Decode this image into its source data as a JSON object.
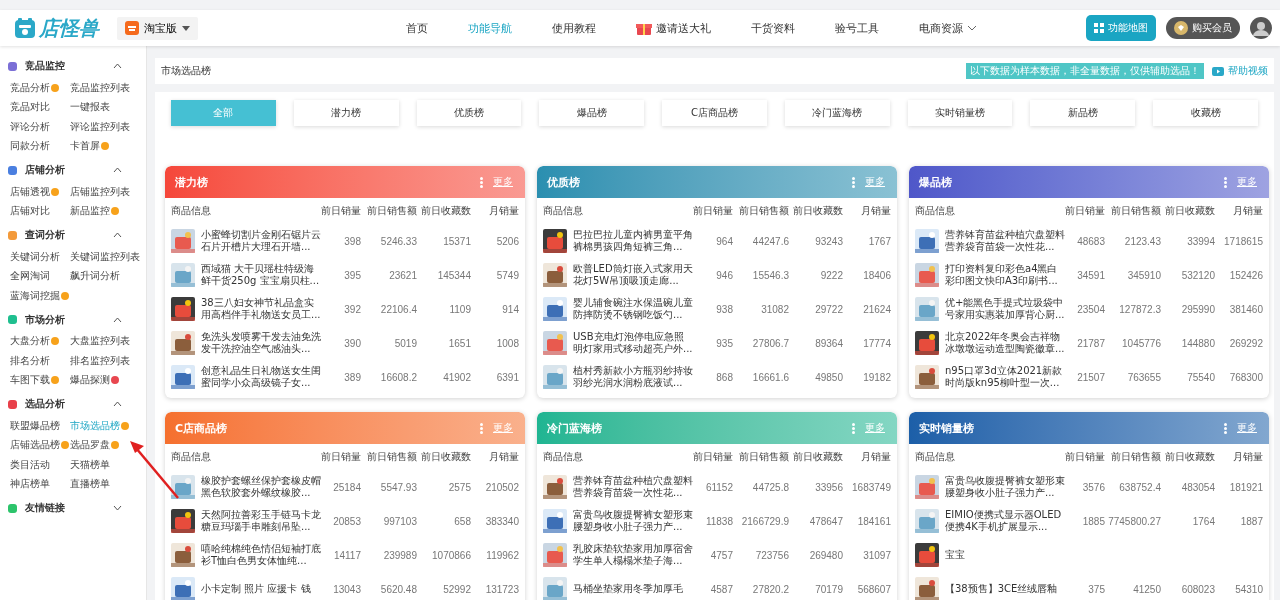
{
  "topbar": {
    "logo": "店怪兽",
    "version": "淘宝版",
    "nav": [
      {
        "label": "首页",
        "selected": false,
        "kind": "plain"
      },
      {
        "label": "功能导航",
        "selected": true,
        "kind": "plain"
      },
      {
        "label": "使用教程",
        "selected": false,
        "kind": "plain"
      },
      {
        "label": "邀请送大礼",
        "selected": false,
        "kind": "gift"
      },
      {
        "label": "干货资料",
        "selected": false,
        "kind": "plain"
      },
      {
        "label": "验号工具",
        "selected": false,
        "kind": "plain"
      },
      {
        "label": "电商资源",
        "selected": false,
        "kind": "dropdown"
      }
    ],
    "map_button": "功能地图",
    "member_button": "购买会员"
  },
  "sidebar": [
    {
      "title": "竞品监控",
      "color": "#7b6fd6",
      "expanded": true,
      "items": [
        {
          "label": "竞品分析",
          "kind": "hot",
          "selected": false
        },
        {
          "label": "竞品监控列表",
          "kind": "plain",
          "selected": false
        },
        {
          "label": "竞品对比",
          "kind": "plain",
          "selected": false
        },
        {
          "label": "一键报表",
          "kind": "plain",
          "selected": false
        },
        {
          "label": "评论分析",
          "kind": "plain",
          "selected": false
        },
        {
          "label": "评论监控列表",
          "kind": "plain",
          "selected": false
        },
        {
          "label": "同款分析",
          "kind": "plain",
          "selected": false
        },
        {
          "label": "卡首屏",
          "kind": "hot",
          "selected": false
        }
      ]
    },
    {
      "title": "店铺分析",
      "color": "#4a7fe0",
      "expanded": true,
      "items": [
        {
          "label": "店铺透视",
          "kind": "hot",
          "selected": false
        },
        {
          "label": "店铺监控列表",
          "kind": "plain",
          "selected": false
        },
        {
          "label": "店铺对比",
          "kind": "plain",
          "selected": false
        },
        {
          "label": "新品监控",
          "kind": "hot",
          "selected": false
        }
      ]
    },
    {
      "title": "查词分析",
      "color": "#f39a3a",
      "expanded": true,
      "items": [
        {
          "label": "关键词分析",
          "kind": "plain",
          "selected": false
        },
        {
          "label": "关键词监控列表",
          "kind": "plain",
          "selected": false
        },
        {
          "label": "全网淘词",
          "kind": "plain",
          "selected": false
        },
        {
          "label": "飙升词分析",
          "kind": "plain",
          "selected": false
        },
        {
          "label": "蓝海词挖掘",
          "kind": "hot",
          "selected": false
        }
      ]
    },
    {
      "title": "市场分析",
      "color": "#1fbf8f",
      "expanded": true,
      "items": [
        {
          "label": "大盘分析",
          "kind": "hot",
          "selected": false
        },
        {
          "label": "大盘监控列表",
          "kind": "plain",
          "selected": false
        },
        {
          "label": "排名分析",
          "kind": "plain",
          "selected": false
        },
        {
          "label": "排名监控列表",
          "kind": "plain",
          "selected": false
        },
        {
          "label": "车图下载",
          "kind": "hot",
          "selected": false
        },
        {
          "label": "爆品探测",
          "kind": "new",
          "selected": false
        }
      ]
    },
    {
      "title": "选品分析",
      "color": "#e8404a",
      "expanded": true,
      "items": [
        {
          "label": "联盟爆品榜",
          "kind": "plain",
          "selected": false
        },
        {
          "label": "市场选品榜",
          "kind": "hot",
          "selected": true
        },
        {
          "label": "店铺选品榜",
          "kind": "hot",
          "selected": false
        },
        {
          "label": "选品罗盘",
          "kind": "hot",
          "selected": false
        },
        {
          "label": "类目活动",
          "kind": "plain",
          "selected": false
        },
        {
          "label": "天猫榜单",
          "kind": "plain",
          "selected": false
        },
        {
          "label": "神店榜单",
          "kind": "plain",
          "selected": false
        },
        {
          "label": "直播榜单",
          "kind": "plain",
          "selected": false
        }
      ]
    },
    {
      "title": "友情链接",
      "color": "#2cc46b",
      "expanded": false
    }
  ],
  "page": {
    "title": "市场选品榜",
    "notice": "以下数据为样本数据，非全量数据，仅供辅助选品！",
    "help": "帮助视频"
  },
  "tabs": [
    {
      "label": "全部",
      "selected": true
    },
    {
      "label": "潜力榜",
      "selected": false
    },
    {
      "label": "优质榜",
      "selected": false
    },
    {
      "label": "爆品榜",
      "selected": false
    },
    {
      "label": "C店商品榜",
      "selected": false
    },
    {
      "label": "冷门蓝海榜",
      "selected": false
    },
    {
      "label": "实时销量榜",
      "selected": false
    },
    {
      "label": "新品榜",
      "selected": false
    },
    {
      "label": "收藏榜",
      "selected": false
    }
  ],
  "cards": [
    {
      "title": "潜力榜",
      "color": "#f5473a",
      "more": "更多",
      "columns": [
        "商品信息",
        "前日销量",
        "前日销售额",
        "前日收藏数",
        "月销量"
      ],
      "rows": [
        {
          "name": "小蜜蜂切割片金刚石锯片云石片开槽片大理石开墙...",
          "sales": "398",
          "revenue": "5246.33",
          "favorites": "15371",
          "monthly": "5206"
        },
        {
          "name": "西域猫 大干贝瑶柱特级海鲜干货250g 宝宝扇贝柱...",
          "sales": "395",
          "revenue": "23621",
          "favorites": "145344",
          "monthly": "5749"
        },
        {
          "name": "38三八妇女神节礼品盒实用高档伴手礼物送女员工...",
          "sales": "392",
          "revenue": "22106.4",
          "favorites": "1109",
          "monthly": "914"
        },
        {
          "name": "免洗头发喷雾干发去油免洗发干洗控油空气感油头...",
          "sales": "390",
          "revenue": "5019",
          "favorites": "1651",
          "monthly": "1008"
        },
        {
          "name": "创意礼品生日礼物送女生闺蜜同学小众高级镜子女...",
          "sales": "389",
          "revenue": "16608.2",
          "favorites": "41902",
          "monthly": "6391"
        }
      ]
    },
    {
      "title": "优质榜",
      "color": "#2a8fb0",
      "more": "更多",
      "columns": [
        "商品信息",
        "前日销量",
        "前日销售额",
        "前日收藏数",
        "月销量"
      ],
      "rows": [
        {
          "name": "巴拉巴拉儿童内裤男童平角裤棉男孩四角短裤三角...",
          "sales": "964",
          "revenue": "44247.6",
          "favorites": "93243",
          "monthly": "1767"
        },
        {
          "name": "欧普LED筒灯嵌入式家用天花灯5W吊顶吸顶走廊...",
          "sales": "946",
          "revenue": "15546.3",
          "favorites": "9222",
          "monthly": "18406"
        },
        {
          "name": "婴儿辅食碗注水保温碗儿童防摔防烫不锈钢吃饭勺...",
          "sales": "938",
          "revenue": "31082",
          "favorites": "29722",
          "monthly": "21624"
        },
        {
          "name": "USB充电灯泡停电应急照明灯家用式移动超亮户外...",
          "sales": "935",
          "revenue": "27806.7",
          "favorites": "89364",
          "monthly": "17774"
        },
        {
          "name": "植村秀新款小方瓶羽纱持妆羽纱光润水润粉底液试...",
          "sales": "868",
          "revenue": "16661.6",
          "favorites": "49850",
          "monthly": "19182"
        }
      ]
    },
    {
      "title": "爆品榜",
      "color": "#4f57c9",
      "more": "更多",
      "columns": [
        "商品信息",
        "前日销量",
        "前日销售额",
        "前日收藏数",
        "月销量"
      ],
      "rows": [
        {
          "name": "营养钵育苗盆种植穴盘塑料营养袋育苗袋一次性花...",
          "sales": "48683",
          "revenue": "2123.43",
          "favorites": "33994",
          "monthly": "1718615"
        },
        {
          "name": "打印资料复印彩色a4黑白彩印图文快印A3印刷书...",
          "sales": "34591",
          "revenue": "345910",
          "favorites": "532120",
          "monthly": "152426"
        },
        {
          "name": "优+能黑色手提式垃圾袋中号家用实惠装加厚背心厨...",
          "sales": "23504",
          "revenue": "127872.3",
          "favorites": "295990",
          "monthly": "381460"
        },
        {
          "name": "北京2022年冬奥会吉祥物冰墩墩运动造型陶瓷徽章...",
          "sales": "21787",
          "revenue": "1045776",
          "favorites": "144880",
          "monthly": "269292"
        },
        {
          "name": "n95口罩3d立体2021新款时尚版kn95柳叶型一次...",
          "sales": "21507",
          "revenue": "763655",
          "favorites": "75540",
          "monthly": "768300"
        }
      ]
    },
    {
      "title": "C店商品榜",
      "color": "#f5702e",
      "more": "更多",
      "columns": [
        "商品信息",
        "前日销量",
        "前日销售额",
        "前日收藏数",
        "月销量"
      ],
      "rows": [
        {
          "name": "橡胶护套螺丝保护套橡皮帽黑色软胶套外螺纹橡胶...",
          "sales": "25184",
          "revenue": "5547.93",
          "favorites": "2575",
          "monthly": "210502"
        },
        {
          "name": "天然阿拉善彩玉手链马卡龙糖豆玛瑙手串雕刻吊坠...",
          "sales": "20853",
          "revenue": "997103",
          "favorites": "658",
          "monthly": "383340"
        },
        {
          "name": "嘻哈纯棉纯色情侣短袖打底衫T恤白色男女体恤纯...",
          "sales": "14117",
          "revenue": "239989",
          "favorites": "1070866",
          "monthly": "119962"
        },
        {
          "name": "小卡定制 照片 应援卡 钱",
          "sales": "13043",
          "revenue": "5620.48",
          "favorites": "52992",
          "monthly": "131723"
        }
      ]
    },
    {
      "title": "冷门蓝海榜",
      "color": "#1fb592",
      "more": "更多",
      "columns": [
        "商品信息",
        "前日销量",
        "前日销售额",
        "前日收藏数",
        "月销量"
      ],
      "rows": [
        {
          "name": "营养钵育苗盆种植穴盘塑料营养袋育苗袋一次性花...",
          "sales": "61152",
          "revenue": "44725.8",
          "favorites": "33956",
          "monthly": "1683749"
        },
        {
          "name": "富贵鸟收腹提臀裤女塑形束腰塑身收小肚子强力产...",
          "sales": "11838",
          "revenue": "2166729.9",
          "favorites": "478647",
          "monthly": "184161"
        },
        {
          "name": "乳胶床垫软垫家用加厚宿舍学生单人榻榻米垫子海...",
          "sales": "4757",
          "revenue": "723756",
          "favorites": "269480",
          "monthly": "31097"
        },
        {
          "name": "马桶坐垫家用冬季加厚毛",
          "sales": "4587",
          "revenue": "27820.2",
          "favorites": "70179",
          "monthly": "568607"
        }
      ]
    },
    {
      "title": "实时销量榜",
      "color": "#1c5fa8",
      "more": "更多",
      "columns": [
        "商品信息",
        "前日销量",
        "前日销售额",
        "前日收藏数",
        "月销量"
      ],
      "rows": [
        {
          "name": "富贵鸟收腹提臀裤女塑形束腰塑身收小肚子强力产...",
          "sales": "3576",
          "revenue": "638752.4",
          "favorites": "483054",
          "monthly": "181921"
        },
        {
          "name": "EIMIO便携式显示器OLED便携4K手机扩展显示...",
          "sales": "1885",
          "revenue": "7745800.27",
          "favorites": "1764",
          "monthly": "1887"
        },
        {
          "name": "宝宝"
        },
        {
          "name": "【38预售】3CE丝绒唇釉",
          "sales": "375",
          "revenue": "41250",
          "favorites": "608023",
          "monthly": "54310"
        }
      ]
    }
  ]
}
